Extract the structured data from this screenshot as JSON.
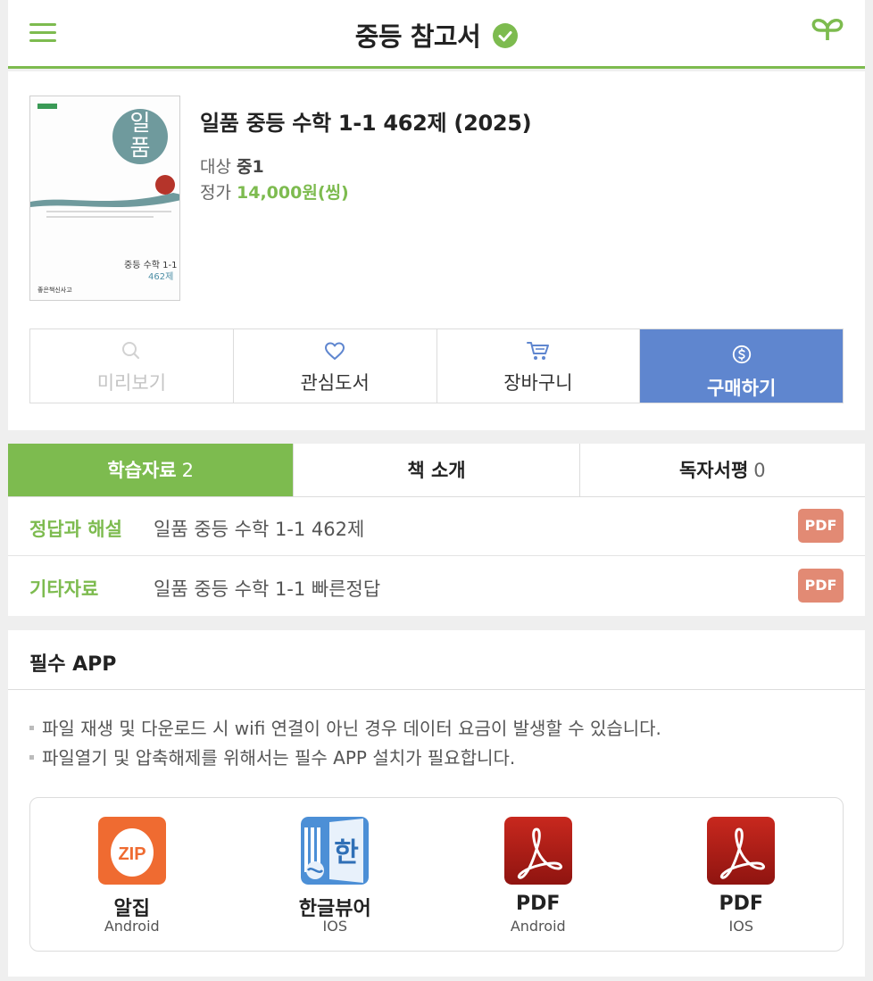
{
  "header": {
    "title": "중등 참고서",
    "menu_icon": "hamburger-menu-icon",
    "verified_icon": "check-circle-icon",
    "logo_icon": "open-book-icon",
    "accent_color": "#7dbb4f"
  },
  "book": {
    "title": "일품 중등 수학 1-1 462제 (2025)",
    "target_label": "대상",
    "target_value": "중1",
    "price_label": "정가",
    "price_value": "14,000원(씽)",
    "cover": {
      "brand": "일품",
      "series": "중등 수학 1-1",
      "count": "462제",
      "publisher": "좋은책신사고"
    }
  },
  "actions": [
    {
      "label": "미리보기",
      "icon": "search-icon",
      "enabled": false
    },
    {
      "label": "관심도서",
      "icon": "heart-icon",
      "enabled": true
    },
    {
      "label": "장바구니",
      "icon": "cart-icon",
      "enabled": true
    },
    {
      "label": "구매하기",
      "icon": "won-coin-icon",
      "enabled": true,
      "color": "#5f86cf"
    }
  ],
  "tabs": [
    {
      "label": "학습자료",
      "count": "2",
      "active": true
    },
    {
      "label": "책 소개",
      "count": "",
      "active": false
    },
    {
      "label": "독자서평",
      "count": "0",
      "active": false
    }
  ],
  "resources": [
    {
      "category": "정답과 해설",
      "name": "일품 중등 수학 1-1 462제",
      "button": "PDF"
    },
    {
      "category": "기타자료",
      "name": "일품 중등 수학 1-1 빠른정답",
      "button": "PDF"
    }
  ],
  "apps_section": {
    "title": "필수 APP",
    "notices": [
      "파일 재생 및 다운로드 시 wifi 연결이 아닌 경우 데이터 요금이 발생할 수 있습니다.",
      "파일열기 및 압축해제를 위해서는 필수 APP 설치가 필요합니다."
    ],
    "apps": [
      {
        "name": "알집",
        "os": "Android",
        "icon": "alzip-icon"
      },
      {
        "name": "한글뷰어",
        "os": "IOS",
        "icon": "hangul-viewer-icon"
      },
      {
        "name": "PDF",
        "os": "Android",
        "icon": "acrobat-pdf-icon"
      },
      {
        "name": "PDF",
        "os": "IOS",
        "icon": "acrobat-pdf-icon"
      }
    ]
  }
}
